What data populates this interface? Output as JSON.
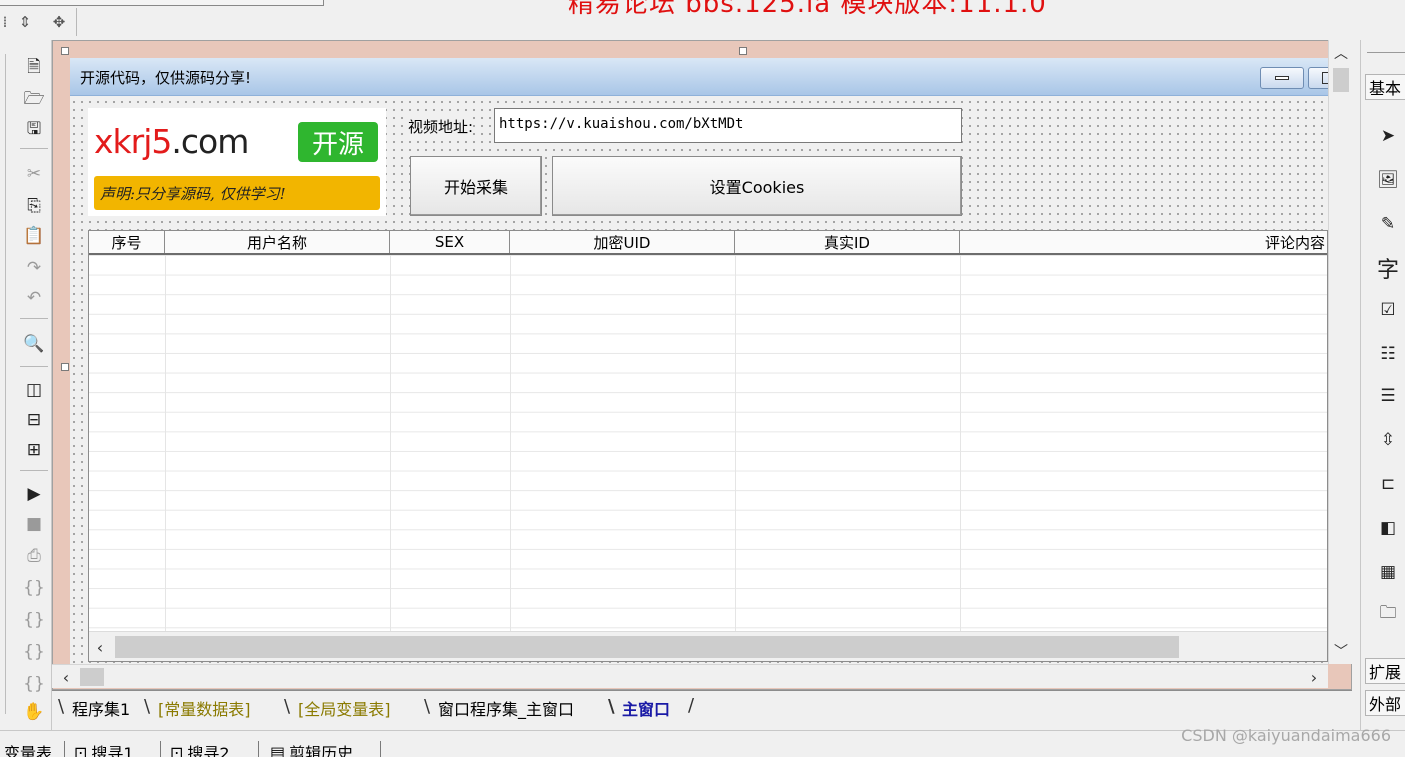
{
  "banner": {
    "text": "精易论坛 bbs.125.la 模块版本:11.1.0"
  },
  "window": {
    "title": "开源代码，仅供源码分享!"
  },
  "logo": {
    "site": "xkrj5",
    "domain": ".com",
    "badge": "开源",
    "slogan": "声明:只分享源码, 仅供学习!"
  },
  "form": {
    "url_label": "视频地址:",
    "url_value": "https://v.kuaishou.com/bXtMDt",
    "start_button": "开始采集",
    "cookies_button": "设置Cookies"
  },
  "table": {
    "columns": [
      "序号",
      "用户名称",
      "SEX",
      "加密UID",
      "真实ID",
      "评论内容"
    ],
    "rows": []
  },
  "tabs": [
    {
      "label": "程序集1",
      "state": "normal"
    },
    {
      "label": "[常量数据表]",
      "state": "olive"
    },
    {
      "label": "[全局变量表]",
      "state": "olive"
    },
    {
      "label": "窗口程序集_主窗口",
      "state": "normal"
    },
    {
      "label": "主窗口",
      "state": "active"
    }
  ],
  "toolbox": {
    "category_basic": "基本",
    "category_ext": "扩展",
    "category_ext2": "外部",
    "label_tool": "字"
  },
  "status_tabs": [
    "变量表",
    "搜寻1",
    "搜寻2",
    "剪辑历史"
  ],
  "watermark": "CSDN @kaiyuandaima666",
  "colors": {
    "designer_bg": "#e8c7ba",
    "title_bar": "#a9c6e7",
    "banner_red": "#e01010",
    "logo_green": "#2fb62f",
    "logo_yellow": "#f2b500"
  },
  "icons": {
    "left_toolbar": [
      "new-file-icon",
      "open-folder-icon",
      "save-icon",
      "cut-icon",
      "copy-icon",
      "paste-icon",
      "redo-icon",
      "undo-icon",
      "find-icon",
      "layout-a-icon",
      "layout-b-icon",
      "layout-c-icon",
      "run-icon",
      "stop-icon",
      "step-icon",
      "step-in-icon",
      "step-out-icon",
      "step-over-icon",
      "run-to-icon",
      "hand-icon"
    ],
    "toolbox": [
      "pointer-icon",
      "picture-box-icon",
      "edit-box-icon",
      "label-icon",
      "checkbox-icon",
      "list-box-icon",
      "combo-box-icon",
      "scroll-icon",
      "progress-icon",
      "tab-icon",
      "table-grid-icon",
      "folder-icon"
    ]
  }
}
